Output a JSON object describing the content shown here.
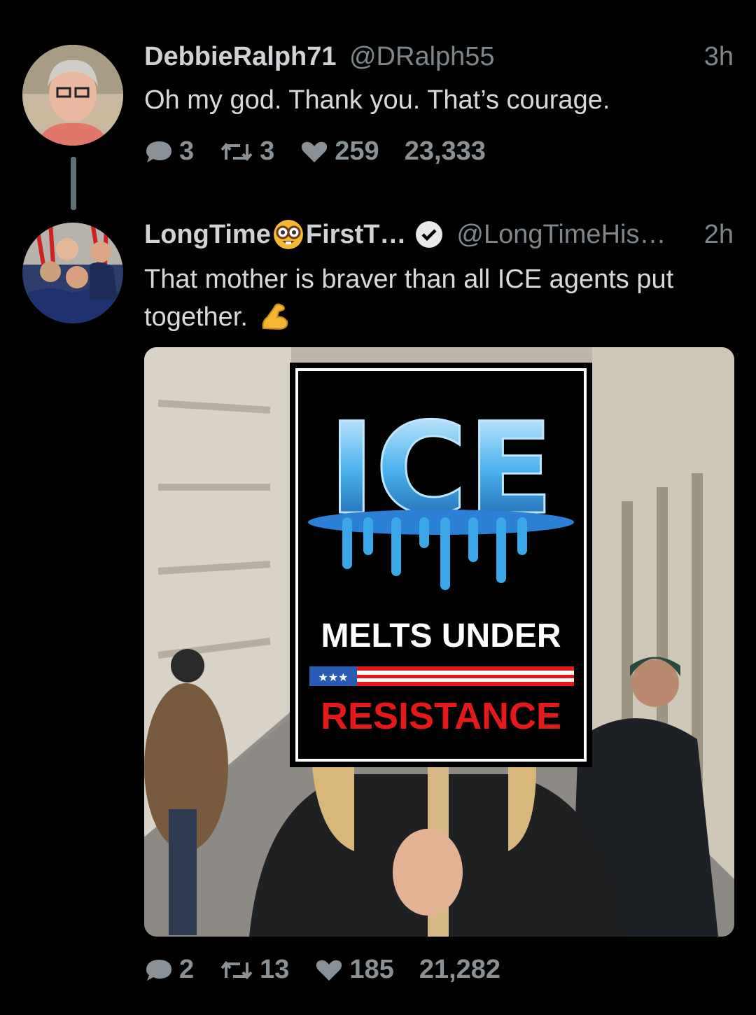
{
  "tweets": [
    {
      "name": "DebbieRalph71",
      "handle": "@DRalph55",
      "time": "3h",
      "text": "Oh my god. Thank you. That’s courage.",
      "replies": "3",
      "retweets": "3",
      "likes": "259",
      "views": "23,333"
    },
    {
      "name_prefix": "LongTime",
      "name_suffix": "FirstT…",
      "handle": "@LongTimeHis…",
      "time": "2h",
      "text": "That mother is braver than all ICE agents put together.",
      "replies": "2",
      "retweets": "13",
      "likes": "185",
      "views": "21,282",
      "sign": {
        "word1": "ICE",
        "line2": "MELTS UNDER",
        "line3": "RESISTANCE"
      }
    }
  ],
  "colors": {
    "background": "#000000",
    "verified": "#e8e8e8",
    "sign_red": "#e3191c",
    "ice_blue": "#3aa7e8"
  }
}
